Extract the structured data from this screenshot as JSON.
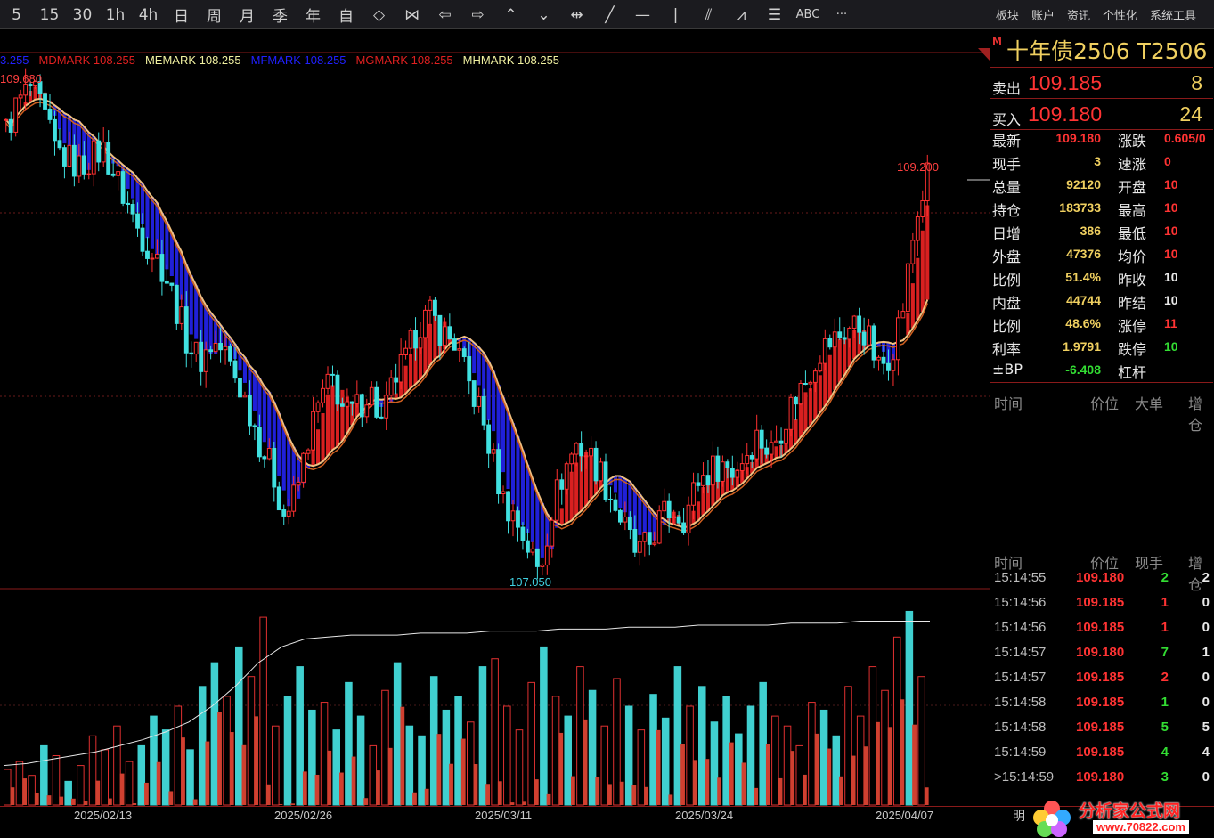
{
  "toolbar": {
    "items": [
      "5",
      "15",
      "30",
      "1h",
      "4h",
      "日",
      "周",
      "月",
      "季",
      "年",
      "自",
      "◇",
      "⋈",
      "⇦",
      "⇨",
      "⌃",
      "⌄",
      "⇹",
      "╱",
      "—",
      "|",
      "⫽",
      "⩘",
      "☰",
      "ABC",
      "···"
    ],
    "right": [
      "板块",
      "账户",
      "资讯",
      "个性化",
      "系统工具"
    ]
  },
  "legend": [
    {
      "text": "3.255",
      "color": "#2222ff"
    },
    {
      "text": "MDMARK 108.255",
      "color": "#e02020"
    },
    {
      "text": "MEMARK 108.255",
      "color": "#f0f0a0"
    },
    {
      "text": "MFMARK 108.255",
      "color": "#2020ff"
    },
    {
      "text": "MGMARK 108.255",
      "color": "#e02020"
    },
    {
      "text": "MHMARK 108.255",
      "color": "#f0f0a0"
    }
  ],
  "annotations": {
    "high": "109.680",
    "low": "107.050",
    "recent_high": "109.200"
  },
  "x_dates": [
    "2025/02/13",
    "2025/02/26",
    "2025/03/11",
    "2025/03/24",
    "2025/04/07"
  ],
  "chart_data": {
    "type": "candlestick",
    "ylim": [
      107.0,
      109.75
    ],
    "price_points": [
      109.45,
      109.6,
      109.68,
      109.55,
      109.35,
      109.3,
      109.25,
      109.3,
      109.35,
      109.2,
      109.05,
      108.9,
      108.8,
      108.7,
      108.5,
      108.3,
      108.2,
      108.3,
      108.25,
      108.1,
      107.95,
      107.75,
      107.6,
      107.35,
      107.5,
      107.8,
      108.0,
      108.1,
      107.9,
      107.95,
      108.05,
      107.85,
      108.1,
      108.2,
      108.4,
      108.45,
      108.35,
      108.3,
      108.1,
      107.95,
      107.7,
      107.45,
      107.35,
      107.2,
      107.05,
      107.4,
      107.6,
      107.75,
      107.7,
      107.6,
      107.45,
      107.3,
      107.15,
      107.2,
      107.35,
      107.4,
      107.35,
      107.55,
      107.6,
      107.65,
      107.6,
      107.7,
      107.8,
      107.7,
      107.85,
      108.0,
      108.1,
      108.25,
      108.3,
      108.35,
      108.4,
      108.35,
      108.15,
      108.25,
      108.5,
      108.95,
      109.2
    ],
    "volume_series": [
      {
        "name": "成交量",
        "values": [
          0.18,
          0.22,
          0.15,
          0.3,
          0.25,
          0.12,
          0.2,
          0.35,
          0.28,
          0.4,
          0.22,
          0.3,
          0.45,
          0.38,
          0.5,
          0.28,
          0.6,
          0.72,
          0.55,
          0.8,
          0.65,
          0.95,
          0.4,
          0.55,
          0.7,
          0.48,
          0.52,
          0.38,
          0.62,
          0.45,
          0.3,
          0.58,
          0.72,
          0.4,
          0.35,
          0.65,
          0.48,
          0.55,
          0.42,
          0.7,
          0.74,
          0.5,
          0.38,
          0.62,
          0.8,
          0.55,
          0.45,
          0.7,
          0.58,
          0.4,
          0.64,
          0.5,
          0.38,
          0.56,
          0.44,
          0.7,
          0.5,
          0.6,
          0.42,
          0.55,
          0.36,
          0.5,
          0.62,
          0.45,
          0.4,
          0.3,
          0.52,
          0.48,
          0.35,
          0.6,
          0.45,
          0.7,
          0.58,
          0.85,
          0.98,
          0.65
        ]
      },
      {
        "name": "持仓",
        "values": [
          0.2,
          0.21,
          0.23,
          0.25,
          0.27,
          0.3,
          0.33,
          0.37,
          0.42,
          0.5,
          0.6,
          0.72,
          0.8,
          0.84,
          0.85,
          0.86,
          0.86,
          0.86,
          0.87,
          0.87,
          0.87,
          0.88,
          0.88,
          0.88,
          0.89,
          0.89,
          0.89,
          0.9,
          0.9,
          0.9,
          0.91,
          0.91,
          0.91,
          0.91,
          0.92,
          0.92,
          0.92,
          0.93,
          0.93,
          0.93,
          0.93
        ]
      }
    ]
  },
  "panel": {
    "m": "M",
    "title": "十年债2506  T2506",
    "sell_label": "卖出",
    "sell_price": "109.185",
    "sell_vol": "8",
    "buy_label": "买入",
    "buy_price": "109.180",
    "buy_vol": "24",
    "stats": [
      {
        "l1": "最新",
        "v1": "109.180",
        "c1": "#ff3333",
        "l2": "涨跌",
        "v2": "0.605/0",
        "c2": "#ff3333"
      },
      {
        "l1": "现手",
        "v1": "3",
        "c1": "#f0d060",
        "l2": "速涨",
        "v2": "0",
        "c2": "#ff3333"
      },
      {
        "l1": "总量",
        "v1": "92120",
        "c1": "#f0d060",
        "l2": "开盘",
        "v2": "10",
        "c2": "#ff3333"
      },
      {
        "l1": "持仓",
        "v1": "183733",
        "c1": "#f0d060",
        "l2": "最高",
        "v2": "10",
        "c2": "#ff3333"
      },
      {
        "l1": "日增",
        "v1": "386",
        "c1": "#f0d060",
        "l2": "最低",
        "v2": "10",
        "c2": "#ff3333"
      },
      {
        "l1": "外盘",
        "v1": "47376",
        "c1": "#f0d060",
        "l2": "均价",
        "v2": "10",
        "c2": "#ff3333"
      },
      {
        "l1": "比例",
        "v1": "51.4%",
        "c1": "#f0d060",
        "l2": "昨收",
        "v2": "10",
        "c2": "#e8e8e8"
      },
      {
        "l1": "内盘",
        "v1": "44744",
        "c1": "#f0d060",
        "l2": "昨结",
        "v2": "10",
        "c2": "#e8e8e8"
      },
      {
        "l1": "比例",
        "v1": "48.6%",
        "c1": "#f0d060",
        "l2": "涨停",
        "v2": "11",
        "c2": "#ff3333"
      },
      {
        "l1": "利率",
        "v1": "1.9791",
        "c1": "#f0d060",
        "l2": "跌停",
        "v2": "10",
        "c2": "#33dd33"
      },
      {
        "l1": "±BP",
        "v1": "-6.408",
        "c1": "#33dd33",
        "l2": "杠杆",
        "v2": "",
        "c2": "#e8e8e8"
      }
    ],
    "hdr1": [
      "时间",
      "价位",
      "大单",
      "增仓"
    ],
    "hdr2": [
      "时间",
      "价位",
      "现手",
      "增仓"
    ],
    "ticks": [
      {
        "t": "15:14:55",
        "p": "109.180",
        "h": "2",
        "hc": "#33dd33",
        "z": "2"
      },
      {
        "t": "15:14:56",
        "p": "109.185",
        "h": "1",
        "hc": "#ff3333",
        "z": "0"
      },
      {
        "t": "15:14:56",
        "p": "109.185",
        "h": "1",
        "hc": "#ff3333",
        "z": "0"
      },
      {
        "t": "15:14:57",
        "p": "109.180",
        "h": "7",
        "hc": "#33dd33",
        "z": "1"
      },
      {
        "t": "15:14:57",
        "p": "109.185",
        "h": "2",
        "hc": "#ff3333",
        "z": "0"
      },
      {
        "t": "15:14:58",
        "p": "109.185",
        "h": "1",
        "hc": "#33dd33",
        "z": "0"
      },
      {
        "t": "15:14:58",
        "p": "109.185",
        "h": "5",
        "hc": "#33dd33",
        "z": "5"
      },
      {
        "t": "15:14:59",
        "p": "109.185",
        "h": "4",
        "hc": "#33dd33",
        "z": "4"
      },
      {
        "t": ">15:14:59",
        "p": "109.180",
        "h": "3",
        "hc": "#33dd33",
        "z": "0"
      }
    ]
  },
  "bottom": {
    "ming": "明",
    "logo": "分析家公式网",
    "url": "www.70822.com"
  }
}
